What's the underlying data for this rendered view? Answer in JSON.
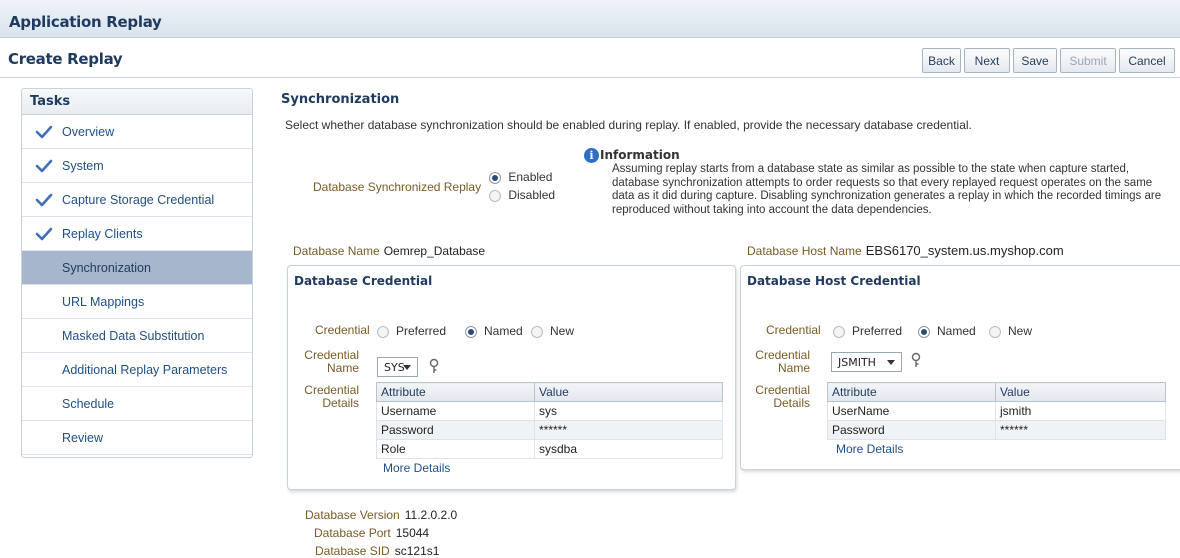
{
  "app_title": "Application Replay",
  "page_title": "Create Replay",
  "buttons": {
    "back": "Back",
    "next": "Next",
    "save": "Save",
    "submit": "Submit",
    "cancel": "Cancel"
  },
  "tasks": {
    "heading": "Tasks",
    "items": [
      {
        "label": "Overview",
        "done": true
      },
      {
        "label": "System",
        "done": true
      },
      {
        "label": "Capture Storage Credential",
        "done": true
      },
      {
        "label": "Replay Clients",
        "done": true
      },
      {
        "label": "Synchronization",
        "selected": true
      },
      {
        "label": "URL Mappings"
      },
      {
        "label": "Masked Data Substitution"
      },
      {
        "label": "Additional Replay Parameters"
      },
      {
        "label": "Schedule"
      },
      {
        "label": "Review"
      }
    ]
  },
  "sync": {
    "title": "Synchronization",
    "description": "Select whether database synchronization should be enabled during replay. If enabled, provide the necessary database credential.",
    "field_label": "Database Synchronized Replay",
    "options": {
      "enabled": "Enabled",
      "disabled": "Disabled"
    },
    "selected": "Enabled"
  },
  "info": {
    "heading": "Information",
    "text": "Assuming replay starts from a database state as similar as possible to the state when capture started, database synchronization attempts to order requests so that every replayed request operates on the same data as it did during capture. Disabling synchronization generates a replay in which the recorded timings are reproduced without taking into account the data dependencies."
  },
  "db_name": {
    "label": "Database Name",
    "value": "Oemrep_Database"
  },
  "db_host_name": {
    "label": "Database Host Name",
    "value": "EBS6170_system.us.myshop.com"
  },
  "db_credential": {
    "title": "Database Credential",
    "credential_label": "Credential",
    "options": {
      "preferred": "Preferred",
      "named": "Named",
      "new": "New"
    },
    "selected": "Named",
    "name_label_1": "Credential",
    "name_label_2": "Name",
    "name_value": "SYS",
    "details_label_1": "Credential",
    "details_label_2": "Details",
    "columns": [
      "Attribute",
      "Value"
    ],
    "rows": [
      [
        "Username",
        "sys"
      ],
      [
        "Password",
        "******"
      ],
      [
        "Role",
        "sysdba"
      ]
    ],
    "more": "More Details"
  },
  "host_credential": {
    "title": "Database Host Credential",
    "credential_label": "Credential",
    "options": {
      "preferred": "Preferred",
      "named": "Named",
      "new": "New"
    },
    "selected": "Named",
    "name_label_1": "Credential",
    "name_label_2": "Name",
    "name_value": "JSMITH",
    "details_label_1": "Credential",
    "details_label_2": "Details",
    "columns": [
      "Attribute",
      "Value"
    ],
    "rows": [
      [
        "UserName",
        "jsmith"
      ],
      [
        "Password",
        "******"
      ]
    ],
    "more": "More Details"
  },
  "db_info": [
    {
      "label": "Database Version",
      "value": "11.2.0.2.0"
    },
    {
      "label": "Database Port",
      "value": "15044"
    },
    {
      "label": "Database SID",
      "value": "sc121s1"
    }
  ]
}
